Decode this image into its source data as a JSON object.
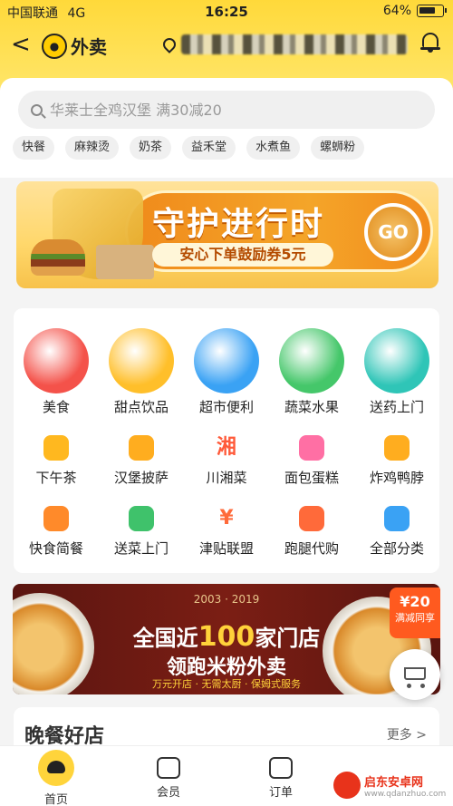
{
  "status_bar": {
    "carrier": "中国联通",
    "network": "4G",
    "time": "16:25",
    "battery": "64%"
  },
  "header": {
    "back_glyph": "<",
    "brand_title": "外卖",
    "address_prefix": "◉"
  },
  "search": {
    "placeholder": "华莱士全鸡汉堡 满30减20"
  },
  "hot_chips": [
    "快餐",
    "麻辣烫",
    "奶茶",
    "益禾堂",
    "水煮鱼",
    "螺蛳粉"
  ],
  "promo_banner": {
    "title": "守护进行时",
    "subtitle": "安心下单鼓励券5元",
    "go_label": "GO"
  },
  "categories_main": [
    {
      "label": "美食",
      "icon": "food-icon",
      "color": "#f4524a"
    },
    {
      "label": "甜点饮品",
      "icon": "dessert-icon",
      "color": "#ffbf2a"
    },
    {
      "label": "超市便利",
      "icon": "basket-icon",
      "color": "#3aa2f4"
    },
    {
      "label": "蔬菜水果",
      "icon": "fruit-icon",
      "color": "#45c76a"
    },
    {
      "label": "送药上门",
      "icon": "medkit-icon",
      "color": "#2fc5b7"
    }
  ],
  "categories_row2": [
    {
      "label": "下午茶",
      "icon": "tea-icon",
      "color": "#ffb81f"
    },
    {
      "label": "汉堡披萨",
      "icon": "burger-icon",
      "color": "#ffad1f"
    },
    {
      "label": "川湘菜",
      "icon": "xiang-icon",
      "color": "#ff5a3a",
      "glyph": "湘"
    },
    {
      "label": "面包蛋糕",
      "icon": "cake-icon",
      "color": "#ff6fa4"
    },
    {
      "label": "炸鸡鸭脖",
      "icon": "drumstick-icon",
      "color": "#ffad1f"
    }
  ],
  "categories_row3": [
    {
      "label": "快食简餐",
      "icon": "bowl-icon",
      "color": "#ff8a2a"
    },
    {
      "label": "送菜上门",
      "icon": "vegetable-icon",
      "color": "#3fc26b"
    },
    {
      "label": "津贴联盟",
      "icon": "moneybag-icon",
      "color": "#ff6a3a",
      "glyph": "¥"
    },
    {
      "label": "跑腿代购",
      "icon": "runner-icon",
      "color": "#ff6a3a"
    },
    {
      "label": "全部分类",
      "icon": "grid-icon",
      "color": "#3aa2f4"
    }
  ],
  "ad_banner": {
    "years": "2003 · 2019",
    "line1_pre": "全国近",
    "line1_num": "100",
    "line1_post": "家门店",
    "line2": "领跑米粉外卖",
    "line3": "万元开店 · 无需太厨 · 保姆式服务",
    "tag_amount": "¥20",
    "tag_text": "满减同享"
  },
  "section": {
    "title": "晚餐好店",
    "more": "更多 >"
  },
  "tabbar": [
    {
      "label": "首页",
      "icon": "home-icon"
    },
    {
      "label": "会员",
      "icon": "crown-icon"
    },
    {
      "label": "订单",
      "icon": "order-icon"
    }
  ],
  "watermark": {
    "title": "启东安卓网",
    "url": "www.qdanzhuo.com"
  }
}
